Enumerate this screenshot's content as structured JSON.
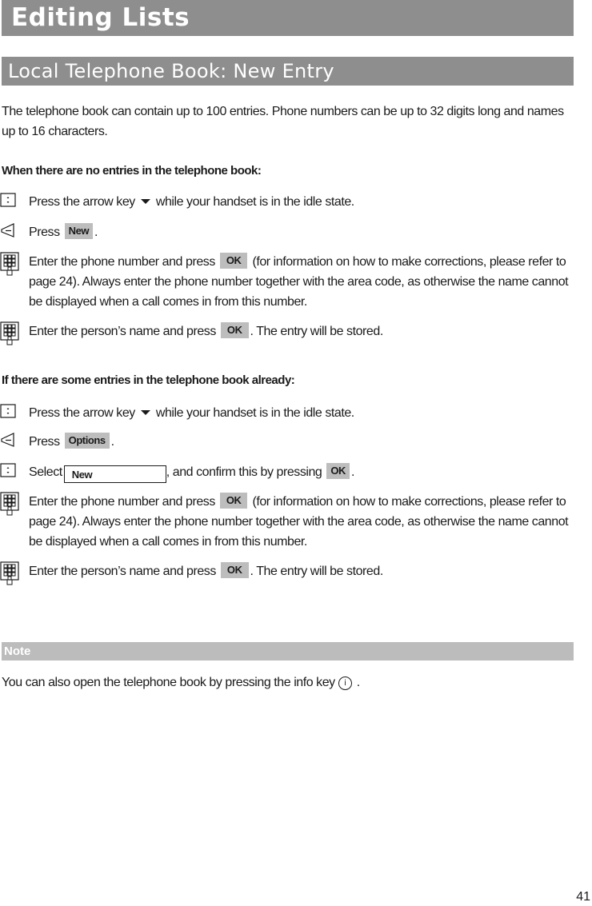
{
  "chapter_title": "Editing Lists",
  "section_title": "Local Telephone Book: New Entry",
  "intro": "The telephone book can contain up to 100 entries. Phone numbers can be up to 32 digits long and names up to 16 characters.",
  "case_empty": {
    "heading": "When there are no entries in the telephone book:",
    "steps": [
      {
        "icon": "navigation-key-icon",
        "before": "Press the arrow key",
        "after": "while your handset is in the idle state."
      },
      {
        "icon": "softkey-icon",
        "before": "Press",
        "key": "New",
        "after": "."
      },
      {
        "icon": "keypad-icon",
        "before": "Enter the phone number and press",
        "key": "OK",
        "after": "(for information on how to make corrections, please refer to  page 24). Always enter the phone number together with the area code, as otherwise the name cannot be displayed when a call comes in from this number."
      },
      {
        "icon": "keypad-icon",
        "before": "Enter the person’s name and press",
        "key": "OK",
        "after": ". The entry will be stored."
      }
    ]
  },
  "case_existing": {
    "heading": "If there are some entries in the telephone book already:",
    "steps": [
      {
        "icon": "navigation-key-icon",
        "before": "Press the arrow key",
        "after": "while your handset is in the idle state."
      },
      {
        "icon": "softkey-icon",
        "before": "Press",
        "key": "Options",
        "after": "."
      },
      {
        "icon": "navigation-key-icon",
        "before": "Select",
        "menu_item": "New",
        "middle": ", and confirm this by pressing",
        "key": "OK",
        "after": "."
      },
      {
        "icon": "keypad-icon",
        "before": "Enter the phone number and press",
        "key": "OK",
        "after": "(for information on how to make corrections, please refer to  page 24). Always enter the phone number together with the area code, as otherwise the name cannot be displayed when a call comes in from this number."
      },
      {
        "icon": "keypad-icon",
        "before": "Enter the person’s name and press",
        "key": "OK",
        "after": ". The entry will be stored."
      }
    ]
  },
  "note": {
    "label": "Note",
    "before": "You can also open the telephone book by pressing the info key",
    "info_glyph": "i",
    "after": "."
  },
  "page_number": "41"
}
